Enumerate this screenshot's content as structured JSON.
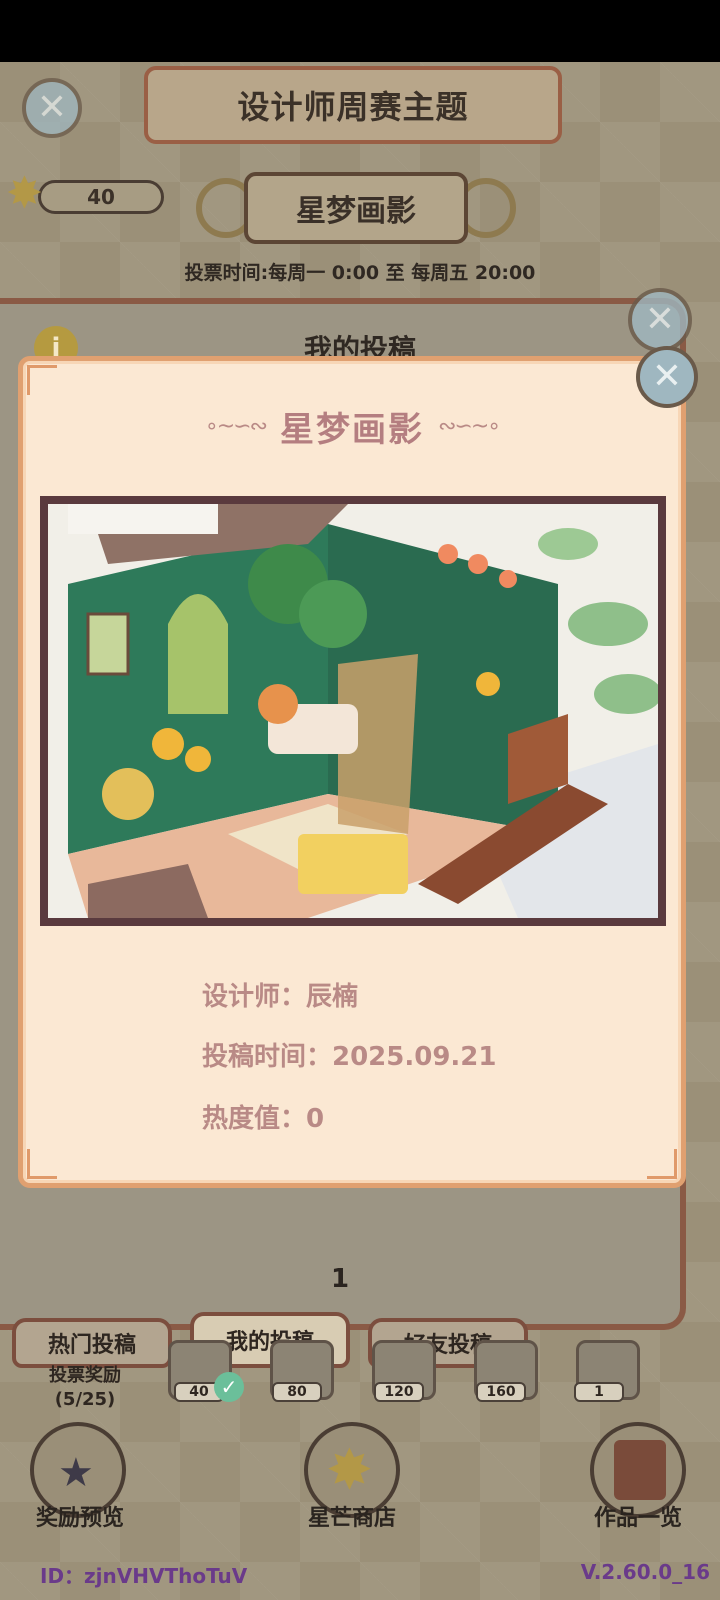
{
  "header": {
    "title": "设计师周赛主题",
    "star_count": "40",
    "theme_name": "星梦画影",
    "vote_time": "投票时间:每周一 0:00 至 每周五 20:00"
  },
  "background_panel": {
    "title": "我的投稿",
    "page_number": "1"
  },
  "tabs": [
    {
      "label": "热门投稿"
    },
    {
      "label": "我的投稿"
    },
    {
      "label": "好友投稿"
    }
  ],
  "rewards": {
    "label_line1": "投票奖励",
    "label_line2": "(5/25)",
    "milestones": [
      "40",
      "80",
      "120",
      "160",
      "1"
    ]
  },
  "bottom_nav": {
    "reward_preview": "奖励预览",
    "star_shop": "星芒商店",
    "works_overview": "作品一览"
  },
  "footer": {
    "user_id": "ID：zjnVHVThoTuV",
    "version": "V.2.60.0_16"
  },
  "modal": {
    "title": "星梦画影",
    "designer": "设计师：辰楠",
    "submit_time": "投稿时间：2025.09.21",
    "heat": "热度值：0"
  },
  "icons": {
    "close": "close-icon",
    "star": "star-icon",
    "info": "info-icon",
    "check": "check-icon"
  },
  "colors": {
    "modal_bg": "#fbe8d3",
    "modal_border": "#e0a070",
    "modal_text": "#b98a86",
    "title_text": "#b47e80"
  }
}
